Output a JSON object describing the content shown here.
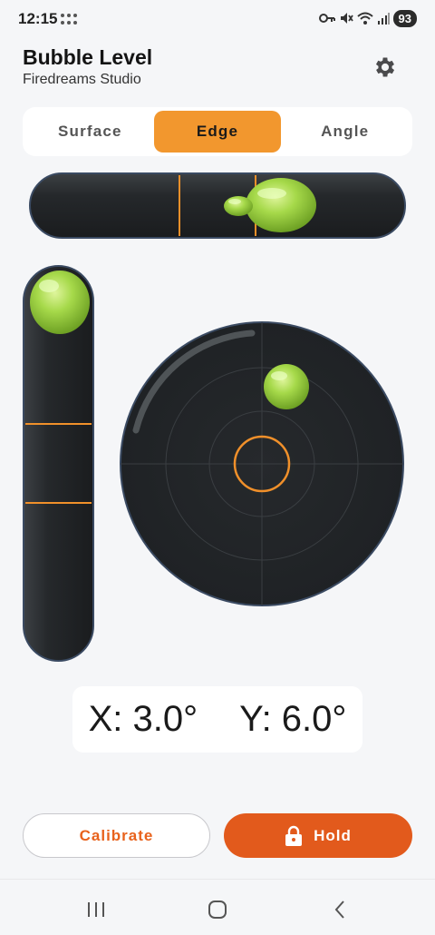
{
  "status_bar": {
    "time": "12:15",
    "battery": "93",
    "icons": [
      "dots-grid-icon",
      "key-icon",
      "mute-icon",
      "wifi-icon",
      "signal-icon"
    ]
  },
  "header": {
    "title": "Bubble Level",
    "subtitle": "Firedreams Studio",
    "settings_icon": "gear-icon"
  },
  "tabs": [
    {
      "label": "Surface",
      "active": false
    },
    {
      "label": "Edge",
      "active": true
    },
    {
      "label": "Angle",
      "active": false
    }
  ],
  "readout": {
    "x": "X: 3.0°",
    "y": "Y: 6.0°"
  },
  "buttons": {
    "calibrate": "Calibrate",
    "hold": "Hold"
  },
  "colors": {
    "accent": "#f2972e",
    "hold": "#e25a1c",
    "bubble": "#9ed43c",
    "tube": "#24272a",
    "marker": "#f0902a"
  },
  "nav": [
    "recent-apps-icon",
    "home-icon",
    "back-icon"
  ]
}
